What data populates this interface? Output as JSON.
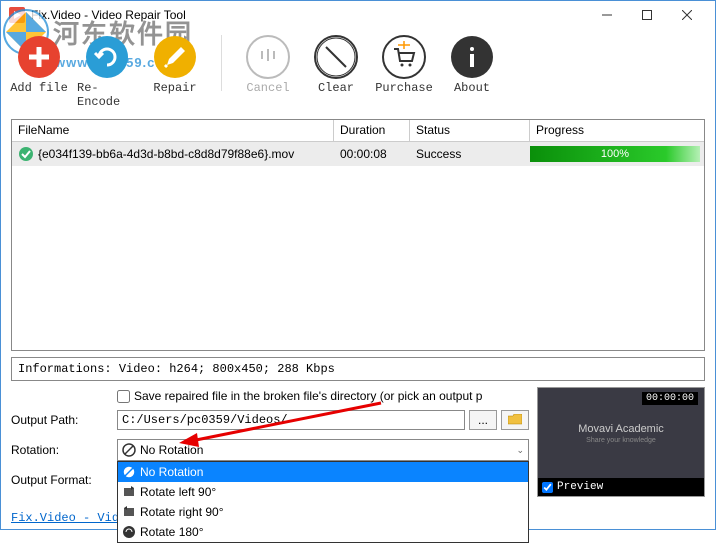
{
  "window": {
    "title": "Fix.Video - Video Repair Tool"
  },
  "toolbar": {
    "add_file": "Add file",
    "re_encode": "Re-Encode",
    "repair": "Repair",
    "cancel": "Cancel",
    "clear": "Clear",
    "purchase": "Purchase",
    "about": "About"
  },
  "table": {
    "headers": {
      "filename": "FileName",
      "duration": "Duration",
      "status": "Status",
      "progress": "Progress"
    },
    "rows": [
      {
        "filename": "{e034f139-bb6a-4d3d-b8bd-c8d8d79f88e6}.mov",
        "duration": "00:00:08",
        "status": "Success",
        "progress": "100%"
      }
    ]
  },
  "info_bar": "Informations:  Video: h264; 800x450; 288 Kbps",
  "form": {
    "save_in_broken": "Save repaired file in the broken file's directory (or pick an output p",
    "output_path_label": "Output Path:",
    "output_path_value": "C:/Users/pc0359/Videos/",
    "browse_dots": "...",
    "rotation_label": "Rotation:",
    "rotation_selected": "No Rotation",
    "rotation_options": [
      "No Rotation",
      "Rotate left 90°",
      "Rotate right 90°",
      "Rotate 180°"
    ],
    "output_format_label": "Output Format:"
  },
  "preview": {
    "time": "00:00:00",
    "title": "Movavi Academic",
    "sub": "Share your knowledge",
    "checkbox_label": "Preview"
  },
  "status_link": "Fix.Video - Vide",
  "watermark": {
    "text1": "河东软件园",
    "text2": "www.pc0359.cn"
  }
}
